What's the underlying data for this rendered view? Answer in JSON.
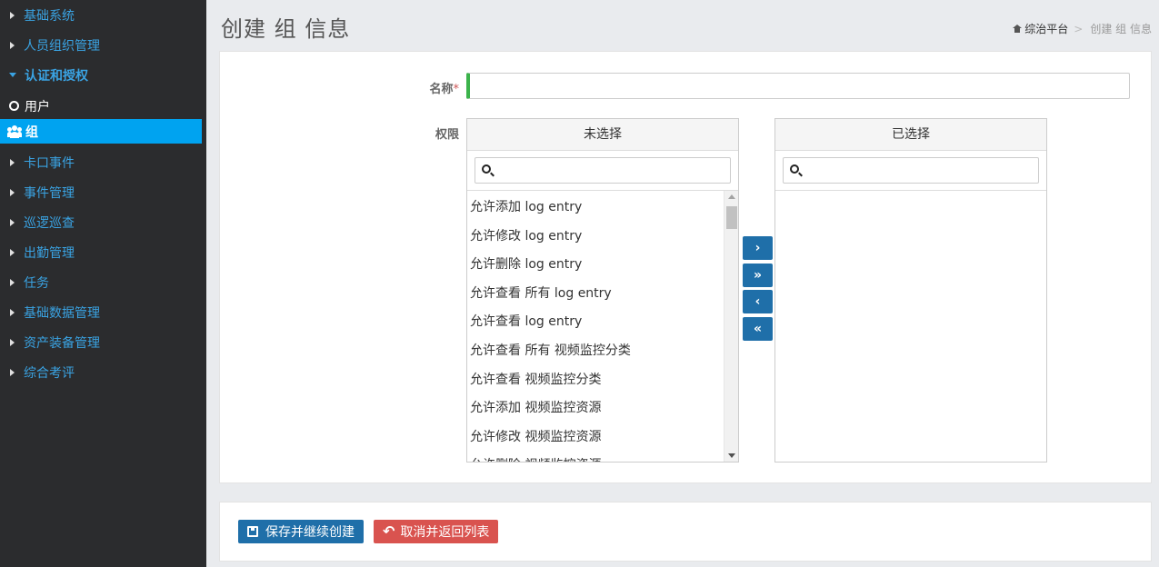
{
  "sidebar": {
    "items": [
      {
        "label": "基础系统"
      },
      {
        "label": "人员组织管理"
      },
      {
        "label": "认证和授权"
      },
      {
        "label": "用户"
      },
      {
        "label": "组"
      },
      {
        "label": "卡口事件"
      },
      {
        "label": "事件管理"
      },
      {
        "label": "巡逻巡查"
      },
      {
        "label": "出勤管理"
      },
      {
        "label": "任务"
      },
      {
        "label": "基础数据管理"
      },
      {
        "label": "资产装备管理"
      },
      {
        "label": "综合考评"
      }
    ]
  },
  "header": {
    "title": "创建 组 信息",
    "breadcrumb": {
      "home": "综治平台",
      "separator": ">",
      "current": "创建 组 信息"
    }
  },
  "form": {
    "name_label": "名称",
    "required_mark": "*",
    "name_value": "",
    "perm_label": "权限"
  },
  "dual_list": {
    "available_title": "未选择",
    "selected_title": "已选择",
    "available_items": [
      "允许添加 log entry",
      "允许修改 log entry",
      "允许删除 log entry",
      "允许查看 所有 log entry",
      "允许查看 log entry",
      "允许查看 所有 视频监控分类",
      "允许查看 视频监控分类",
      "允许添加 视频监控资源",
      "允许修改 视频监控资源",
      "允许删除 视频监控资源"
    ],
    "selected_items": [],
    "buttons": {
      "move_right": "›",
      "move_all_right": "»",
      "move_left": "‹",
      "move_all_left": "«"
    }
  },
  "actions": {
    "save_continue": "保存并继续创建",
    "cancel_return": "取消并返回列表"
  },
  "colors": {
    "sidebar_bg": "#2b2c2e",
    "sidebar_link": "#3aa3e3",
    "active_bg": "#00a3f0",
    "primary": "#1f6fa9",
    "danger": "#d9534f",
    "required_indicator": "#3cb34b"
  }
}
